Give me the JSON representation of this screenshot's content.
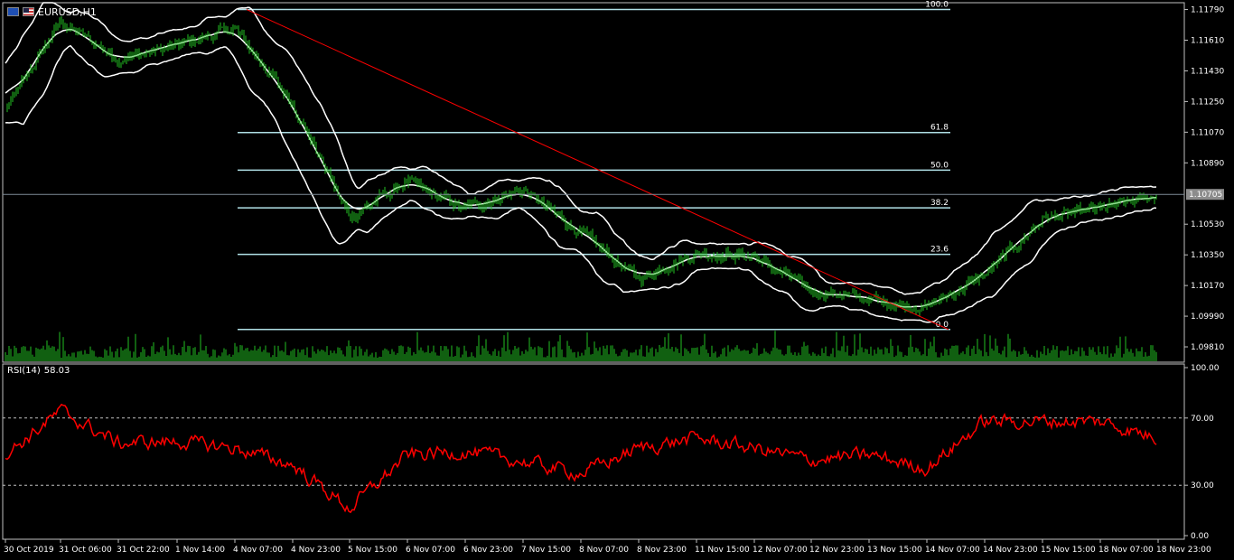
{
  "chart_title": "EURUSD,H1",
  "symbol_flags": [
    "EU",
    "US"
  ],
  "colors": {
    "background": "#000000",
    "frame": "#c0c0c0",
    "candle_up": "#22c022",
    "volume": "#22c022",
    "bollinger": "#ffffff",
    "fib_levels": "#b0e0e6",
    "trendline": "#ff0000",
    "rsi_line": "#ff0000",
    "price_marker_bg": "#8c8c8c"
  },
  "price_axis": {
    "labels": [
      "1.11790",
      "1.11610",
      "1.11430",
      "1.11250",
      "1.11070",
      "1.10890",
      "1.10530",
      "1.10350",
      "1.10170",
      "1.09990",
      "1.09810"
    ],
    "current_price": "1.10705"
  },
  "rsi": {
    "label": "RSI(14)",
    "value": "58.03",
    "axis_labels": [
      "100.00",
      "70.00",
      "30.00",
      "0.00"
    ],
    "levels": [
      70,
      30
    ]
  },
  "time_axis": {
    "labels": [
      "30 Oct 2019",
      "31 Oct 06:00",
      "31 Oct 22:00",
      "1 Nov 14:00",
      "4 Nov 07:00",
      "4 Nov 23:00",
      "5 Nov 15:00",
      "6 Nov 07:00",
      "6 Nov 23:00",
      "7 Nov 15:00",
      "8 Nov 07:00",
      "8 Nov 23:00",
      "11 Nov 15:00",
      "12 Nov 07:00",
      "12 Nov 23:00",
      "13 Nov 15:00",
      "14 Nov 07:00",
      "14 Nov 23:00",
      "15 Nov 15:00",
      "18 Nov 07:00",
      "18 Nov 23:00"
    ]
  },
  "fibonacci": {
    "levels": [
      {
        "label": "100.0",
        "price": 1.1179
      },
      {
        "label": "61.8",
        "price": 1.11068
      },
      {
        "label": "50.0",
        "price": 1.10847
      },
      {
        "label": "38.2",
        "price": 1.10626
      },
      {
        "label": "23.6",
        "price": 1.10353
      },
      {
        "label": "0.0",
        "price": 1.09912
      }
    ]
  },
  "chart_data": {
    "type": "line",
    "title": "EURUSD,H1",
    "xlabel": "",
    "ylabel": "",
    "ylim": [
      1.0972,
      1.1183
    ],
    "y_ticks": [
      1.1179,
      1.1161,
      1.1143,
      1.1125,
      1.1107,
      1.1089,
      1.1053,
      1.1035,
      1.1017,
      1.0999,
      1.0981
    ],
    "grid": false,
    "x": [
      "30 Oct 2019",
      "31 Oct 06:00",
      "31 Oct 22:00",
      "1 Nov 14:00",
      "4 Nov 07:00",
      "4 Nov 23:00",
      "5 Nov 15:00",
      "6 Nov 07:00",
      "6 Nov 23:00",
      "7 Nov 15:00",
      "8 Nov 07:00",
      "8 Nov 23:00",
      "11 Nov 15:00",
      "12 Nov 07:00",
      "12 Nov 23:00",
      "13 Nov 15:00",
      "14 Nov 07:00",
      "14 Nov 23:00",
      "15 Nov 15:00",
      "18 Nov 07:00",
      "18 Nov 23:00"
    ],
    "series": [
      {
        "values": [
          1.112,
          1.1172,
          1.115,
          1.1158,
          1.1168,
          1.1124,
          1.1057,
          1.1078,
          1.1062,
          1.1073,
          1.1048,
          1.1021,
          1.1036,
          1.1034,
          1.1014,
          1.1009,
          1.1004,
          1.1023,
          1.1056,
          1.1062,
          1.107
        ]
      }
    ],
    "rsi_values": [
      48,
      74,
      55,
      56,
      52,
      42,
      16,
      48,
      50,
      44,
      37,
      52,
      58,
      52,
      45,
      48,
      40,
      68,
      68,
      68,
      58
    ]
  }
}
